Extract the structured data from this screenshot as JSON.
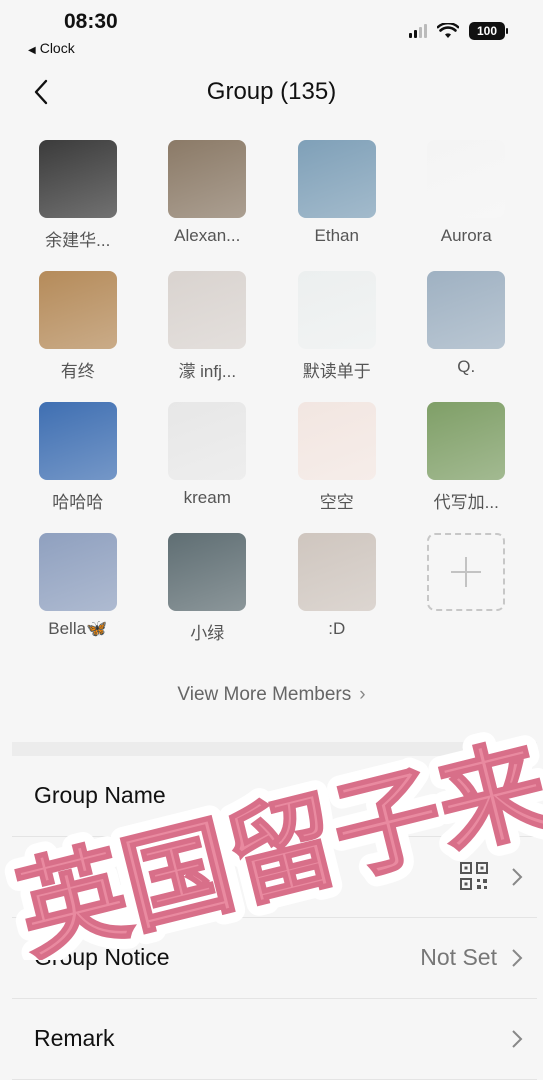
{
  "status_bar": {
    "time": "08:30",
    "back_app": "Clock",
    "battery": "100"
  },
  "header": {
    "title": "Group (135)"
  },
  "members": [
    {
      "name": "余建华...",
      "bg": "#3b3b3b"
    },
    {
      "name": "Alexan...",
      "bg": "#8b7a67"
    },
    {
      "name": "Ethan",
      "bg": "#7fa0b8"
    },
    {
      "name": "Aurora",
      "bg": "#f4f4f4"
    },
    {
      "name": "有终",
      "bg": "#b58b5a"
    },
    {
      "name": "濛 infj...",
      "bg": "#d9d3cf"
    },
    {
      "name": "默读单于",
      "bg": "#ecefef"
    },
    {
      "name": "Q.",
      "bg": "#9fb1c2"
    },
    {
      "name": "哈哈哈",
      "bg": "#3f6fb2"
    },
    {
      "name": "kream",
      "bg": "#e7e7e7"
    },
    {
      "name": "空空",
      "bg": "#f2e6e1"
    },
    {
      "name": "代写加...",
      "bg": "#7f9f67"
    },
    {
      "name": "Bella🦋",
      "bg": "#8fa0bf"
    },
    {
      "name": "小绿",
      "bg": "#5f6e73"
    },
    {
      "name": ":D",
      "bg": "#cfc6bf"
    }
  ],
  "view_more": "View More Members",
  "settings": {
    "group_name_label": "Group Name",
    "qr_label": "",
    "group_notice_label": "Group Notice",
    "group_notice_value": "Not Set",
    "remark_label": "Remark"
  },
  "watermark": "英国留子来",
  "colors": {
    "sticker_pink": "#e98aa0",
    "background": "#f6f6f6"
  }
}
